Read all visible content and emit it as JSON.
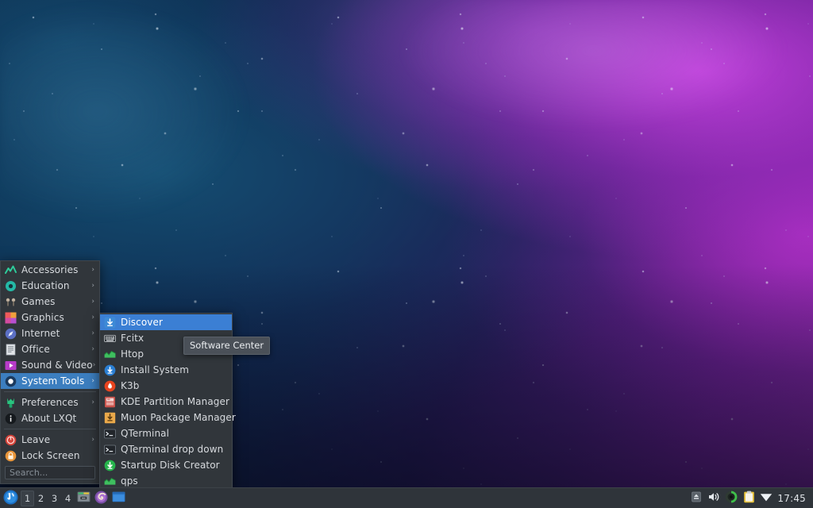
{
  "desktop": {
    "wallpaper_name": "nebula-wallpaper",
    "colors": {
      "deep_blue": "#0a2a45",
      "purple": "#8d27a8",
      "magenta": "#c440de"
    }
  },
  "main_menu": {
    "name": "lxqt-application-menu",
    "items": [
      {
        "label": "Accessories",
        "icon": "accessories-icon",
        "icon_color": "#2ecc9b",
        "has_submenu": true,
        "selected": false
      },
      {
        "label": "Education",
        "icon": "education-icon",
        "icon_color": "#24b9a6",
        "has_submenu": true,
        "selected": false
      },
      {
        "label": "Games",
        "icon": "games-icon",
        "icon_color": "#b7a99a",
        "has_submenu": true,
        "selected": false
      },
      {
        "label": "Graphics",
        "icon": "graphics-icon",
        "icon_color": "#e0547c",
        "has_submenu": true,
        "selected": false
      },
      {
        "label": "Internet",
        "icon": "internet-icon",
        "icon_color": "#5b7ddb",
        "has_submenu": true,
        "selected": false
      },
      {
        "label": "Office",
        "icon": "office-icon",
        "icon_color": "#d7dce0",
        "has_submenu": true,
        "selected": false
      },
      {
        "label": "Sound & Video",
        "icon": "sound-video-icon",
        "icon_color": "#b83bc9",
        "has_submenu": true,
        "selected": false
      },
      {
        "label": "System Tools",
        "icon": "system-tools-icon",
        "icon_color": "#2b4c7e",
        "has_submenu": true,
        "selected": true
      }
    ],
    "items2": [
      {
        "label": "Preferences",
        "icon": "preferences-icon",
        "icon_color": "#29c47f",
        "has_submenu": true,
        "selected": false
      },
      {
        "label": "About LXQt",
        "icon": "about-icon",
        "icon_color": "#15191d",
        "has_submenu": false,
        "selected": false
      }
    ],
    "items3": [
      {
        "label": "Leave",
        "icon": "leave-power-icon",
        "icon_color": "#d4453c",
        "has_submenu": true,
        "selected": false
      },
      {
        "label": "Lock Screen",
        "icon": "lock-screen-icon",
        "icon_color": "#e8953a",
        "has_submenu": false,
        "selected": false
      }
    ],
    "search": {
      "placeholder": "Search...",
      "value": ""
    },
    "arrow_glyph": "›"
  },
  "sub_menu": {
    "name": "system-tools-submenu",
    "items": [
      {
        "label": "Discover",
        "icon": "discover-icon",
        "icon_color": "#3d8ad6",
        "selected": true
      },
      {
        "label": "Fcitx",
        "icon": "fcitx-keyboard-icon",
        "icon_color": "#c8ccd0",
        "selected": false
      },
      {
        "label": "Htop",
        "icon": "htop-icon",
        "icon_color": "#3fbf5f",
        "selected": false
      },
      {
        "label": "Install System",
        "icon": "install-system-icon",
        "icon_color": "#2a7fd4",
        "selected": false
      },
      {
        "label": "K3b",
        "icon": "k3b-icon",
        "icon_color": "#e8441f",
        "selected": false
      },
      {
        "label": "KDE Partition Manager",
        "icon": "partition-manager-icon",
        "icon_color": "#c94a44",
        "selected": false
      },
      {
        "label": "Muon Package Manager",
        "icon": "muon-package-icon",
        "icon_color": "#e8a33d",
        "selected": false
      },
      {
        "label": "QTerminal",
        "icon": "qterminal-icon",
        "icon_color": "#2b3036",
        "selected": false
      },
      {
        "label": "QTerminal drop down",
        "icon": "qterminal-dropdown-icon",
        "icon_color": "#2b3036",
        "selected": false
      },
      {
        "label": "Startup Disk Creator",
        "icon": "startup-disk-creator-icon",
        "icon_color": "#26b44c",
        "selected": false
      },
      {
        "label": "qps",
        "icon": "qps-icon",
        "icon_color": "#3fbf5f",
        "selected": false
      }
    ]
  },
  "tooltip": {
    "text": "Software Center"
  },
  "taskbar": {
    "start_button": {
      "name": "start-menu-button",
      "icon": "lxqt-logo-icon"
    },
    "desktops": [
      {
        "label": "1",
        "active": true
      },
      {
        "label": "2",
        "active": false
      },
      {
        "label": "3",
        "active": false
      },
      {
        "label": "4",
        "active": false
      }
    ],
    "quick_launch": [
      {
        "name": "file-manager-icon",
        "label": "File Manager"
      },
      {
        "name": "web-browser-icon",
        "label": "Web Browser"
      },
      {
        "name": "window-app-icon",
        "label": "Application"
      }
    ],
    "tray": [
      {
        "name": "eject-icon",
        "label": "Eject"
      },
      {
        "name": "volume-icon",
        "label": "Volume"
      },
      {
        "name": "battery-icon",
        "label": "Battery"
      },
      {
        "name": "clipboard-icon",
        "label": "Clipboard"
      },
      {
        "name": "network-icon",
        "label": "Network"
      }
    ],
    "clock": "17:45"
  }
}
